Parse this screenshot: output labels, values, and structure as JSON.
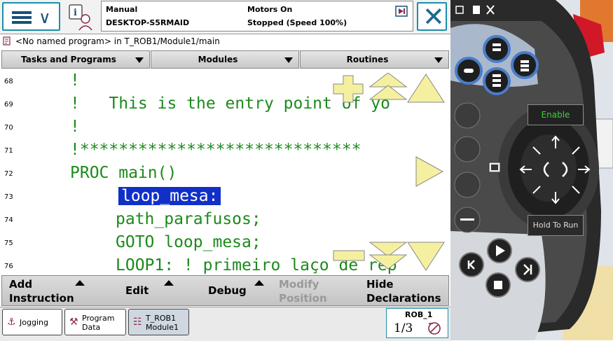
{
  "status": {
    "mode": "Manual",
    "controller": "DESKTOP-S5RMAID",
    "motors": "Motors On",
    "state": "Stopped (Speed 100%)"
  },
  "breadcrumb": "<No named program> in T_ROB1/Module1/main",
  "tabs": [
    {
      "label": "Tasks and Programs"
    },
    {
      "label": "Modules"
    },
    {
      "label": "Routines"
    }
  ],
  "code_lines": [
    {
      "num": "68",
      "text": "!"
    },
    {
      "num": "69",
      "text": "!   This is the entry point of yo"
    },
    {
      "num": "70",
      "text": "!"
    },
    {
      "num": "71",
      "text": "!*****************************"
    },
    {
      "num": "72",
      "text": "PROC main()"
    },
    {
      "num": "73",
      "text": "loop_mesa:"
    },
    {
      "num": "74",
      "text": "path_parafusos;"
    },
    {
      "num": "75",
      "text": "GOTO loop_mesa;"
    },
    {
      "num": "76",
      "text": "LOOP1: ! primeiro laço de rep"
    }
  ],
  "bottom_menu": {
    "add_instruction": [
      "Add",
      "Instruction"
    ],
    "edit": "Edit",
    "debug": "Debug",
    "modify_position": [
      "Modify",
      "Position"
    ],
    "hide_declarations": [
      "Hide",
      "Declarations"
    ]
  },
  "taskbar": {
    "jogging": "Jogging",
    "program_data": [
      "Program",
      "Data"
    ],
    "module": [
      "T_ROB1",
      "Module1"
    ],
    "rob_label": "ROB_1",
    "rob_fraction": "1/3"
  },
  "pendant": {
    "enable": "Enable",
    "hold_to_run": "Hold To Run"
  },
  "colors": {
    "accent": "#1c8ea8",
    "code_green": "#1c8a1c",
    "highlight": "#1030c8",
    "overlay_yellow": "#f5f0a0"
  }
}
